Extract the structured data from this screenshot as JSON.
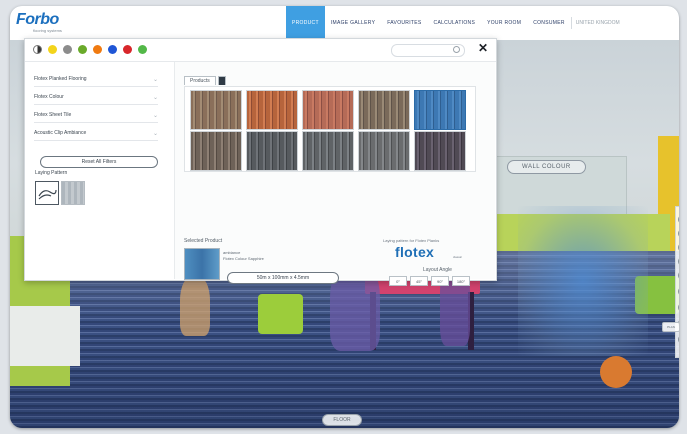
{
  "brand": {
    "logo_text": "Forbo",
    "logo_sub": "flooring systems"
  },
  "nav": {
    "items": [
      "PRODUCT",
      "IMAGE GALLERY",
      "FAVOURITES",
      "CALCULATIONS",
      "YOUR ROOM",
      "CONSUMER"
    ],
    "active_index": 0,
    "language": "UNITED KINGDOM"
  },
  "panel": {
    "colour_filters": [
      "#444444",
      "#f3d41b",
      "#8c8c8c",
      "#6aaa2a",
      "#f07a10",
      "#1f56d6",
      "#d8262a",
      "#53b848"
    ],
    "filters": [
      "Flotex Planked Flooring",
      "Flotex Colour",
      "Flotex Sheet Tile",
      "Acoustic Clip Ambiance"
    ],
    "reset_label": "Reset All Filters",
    "laying_label": "Laying Pattern",
    "tabs": [
      "Products",
      ""
    ],
    "tiles": [
      {
        "colors": [
          "#8a6f5a",
          "#a38c74",
          "#6f5a4c"
        ]
      },
      {
        "colors": [
          "#b6643c",
          "#d27d52",
          "#8f4c34"
        ]
      },
      {
        "colors": [
          "#b56b57",
          "#c97a62",
          "#8d4f44"
        ]
      },
      {
        "colors": [
          "#7a6a5a",
          "#9a8a76",
          "#5f5349"
        ]
      },
      {
        "colors": [
          "#3d78b3",
          "#4f8ac4",
          "#2f5f91"
        ]
      },
      {
        "colors": [
          "#6e6258",
          "#8e8074",
          "#544a42"
        ]
      },
      {
        "colors": [
          "#565a5e",
          "#6f7378",
          "#3f4347"
        ]
      },
      {
        "colors": [
          "#5f6366",
          "#7c8185",
          "#474a4d"
        ]
      },
      {
        "colors": [
          "#6a6c6e",
          "#84878a",
          "#4e5052"
        ]
      },
      {
        "colors": [
          "#504a54",
          "#6a6270",
          "#3c3640"
        ]
      }
    ],
    "selected_tile_index": 4,
    "selected_label": "Selected Product",
    "product_name": "ambiance",
    "product_sub": "Flotex Colour Sapphire",
    "size_button": "50m x 100mm x 4.5mm",
    "brand_note": "Laying pattern for Flotex Planks",
    "brand_name": "flotex",
    "brand_tag": "classic",
    "angle_label": "Layout Angle",
    "angles": [
      "0°",
      "45°",
      "90°",
      "180°"
    ],
    "search_placeholder": ""
  },
  "scene": {
    "wall_label": "WALL COLOUR",
    "floor_label": "FLOOR",
    "right_label": "PLAN"
  }
}
